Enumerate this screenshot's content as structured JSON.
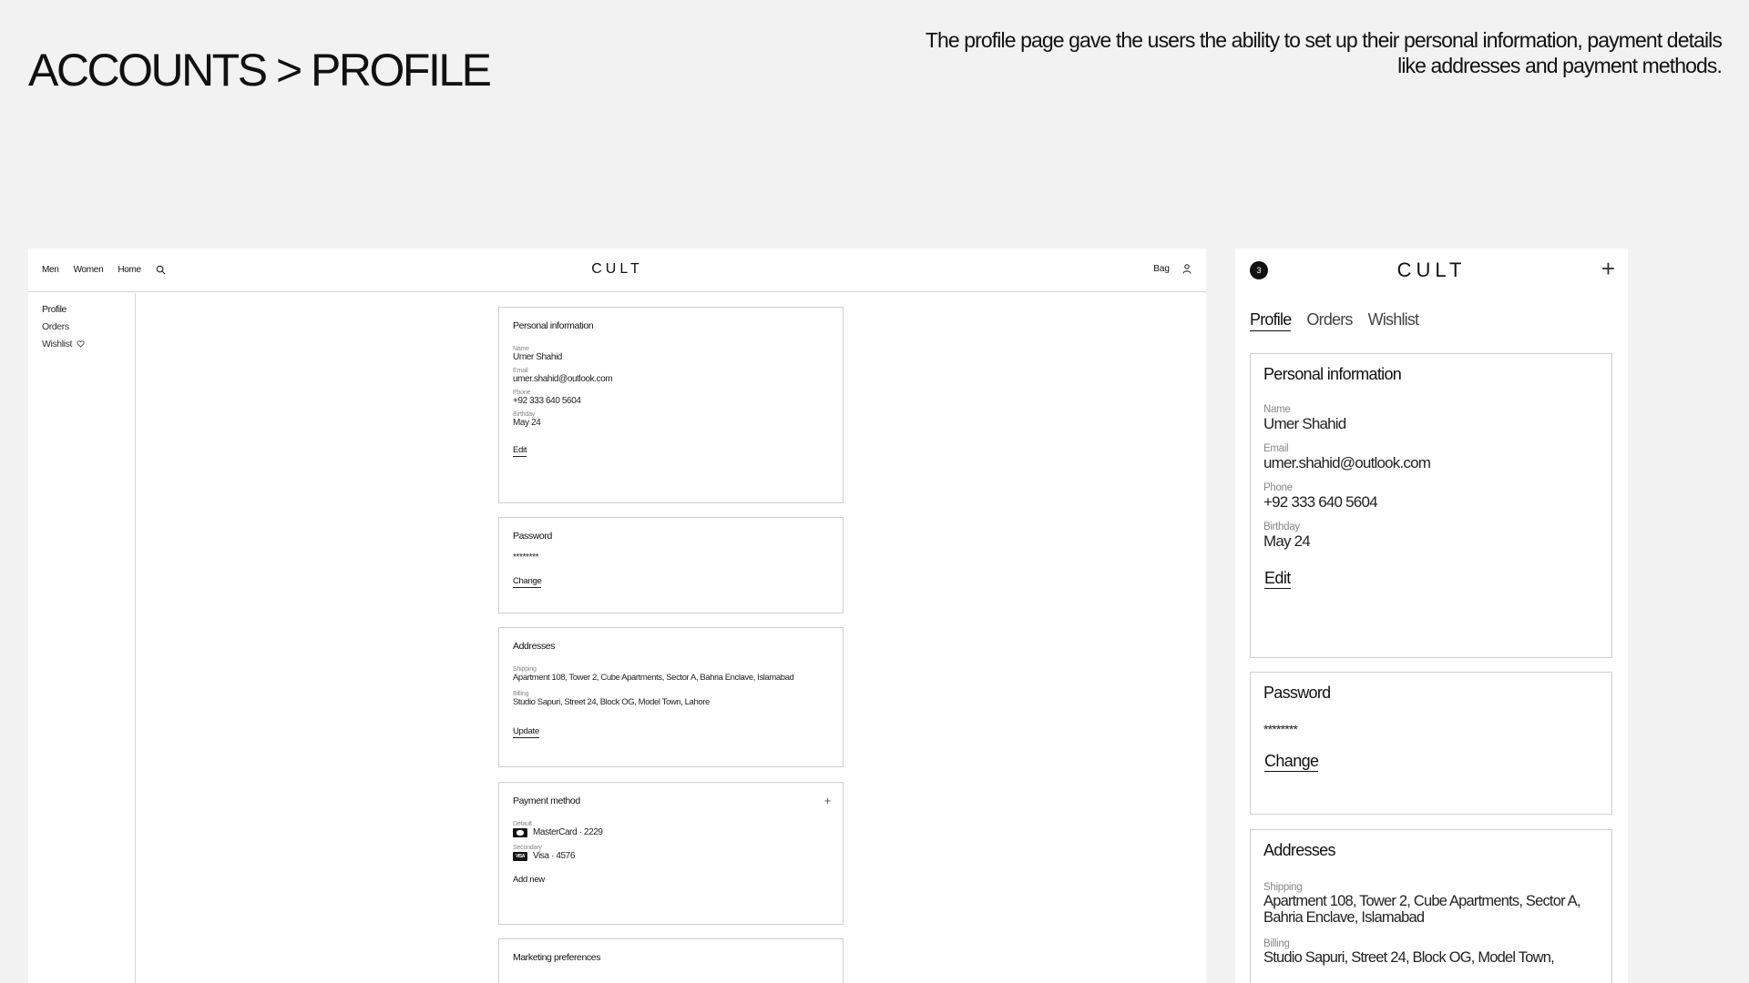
{
  "slide": {
    "title": "ACCOUNTS > PROFILE",
    "description": "The profile page gave the users the ability to set up their personal information, payment details like addresses and payment methods."
  },
  "desktop": {
    "nav": {
      "men": "Men",
      "women": "Women",
      "home": "Home"
    },
    "logo": "CULT",
    "bag": "Bag",
    "sidebar": {
      "profile": "Profile",
      "orders": "Orders",
      "wishlist": "Wishlist"
    },
    "personal": {
      "title": "Personal information",
      "name_label": "Name",
      "name": "Umer Shahid",
      "email_label": "Email",
      "email": "umer.shahid@outlook.com",
      "phone_label": "Phone",
      "phone": "+92 333 640 5604",
      "birthday_label": "Birthday",
      "birthday": "May 24",
      "edit": "Edit"
    },
    "password": {
      "title": "Password",
      "value": "********",
      "change": "Change"
    },
    "addresses": {
      "title": "Addresses",
      "shipping_label": "Shipping",
      "shipping": "Apartment 108, Tower 2, Cube Apartments, Sector A, Bahria Enclave, Islamabad",
      "billing_label": "Billing",
      "billing": "Studio Sapuri, Street 24, Block OG, Model Town, Lahore",
      "update": "Update"
    },
    "payment": {
      "title": "Payment method",
      "default_label": "Default",
      "default": "MasterCard · 2229",
      "secondary_label": "Secondary",
      "secondary": "Visa · 4576",
      "visa_badge": "VISA",
      "add_new": "Add new"
    },
    "marketing": {
      "title": "Marketing preferences"
    }
  },
  "mobile": {
    "badge": "3",
    "logo": "CULT",
    "tabs": {
      "profile": "Profile",
      "orders": "Orders",
      "wishlist": "Wishlist"
    },
    "personal": {
      "title": "Personal information",
      "name_label": "Name",
      "name": "Umer Shahid",
      "email_label": "Email",
      "email": "umer.shahid@outlook.com",
      "phone_label": "Phone",
      "phone": "+92 333 640 5604",
      "birthday_label": "Birthday",
      "birthday": "May 24",
      "edit": "Edit"
    },
    "password": {
      "title": "Password",
      "value": "********",
      "change": "Change"
    },
    "addresses": {
      "title": "Addresses",
      "shipping_label": "Shipping",
      "shipping": "Apartment 108, Tower 2, Cube Apartments, Sector A, Bahria Enclave, Islamabad",
      "billing_label": "Billing",
      "billing": "Studio Sapuri, Street 24, Block OG, Model Town,"
    }
  }
}
